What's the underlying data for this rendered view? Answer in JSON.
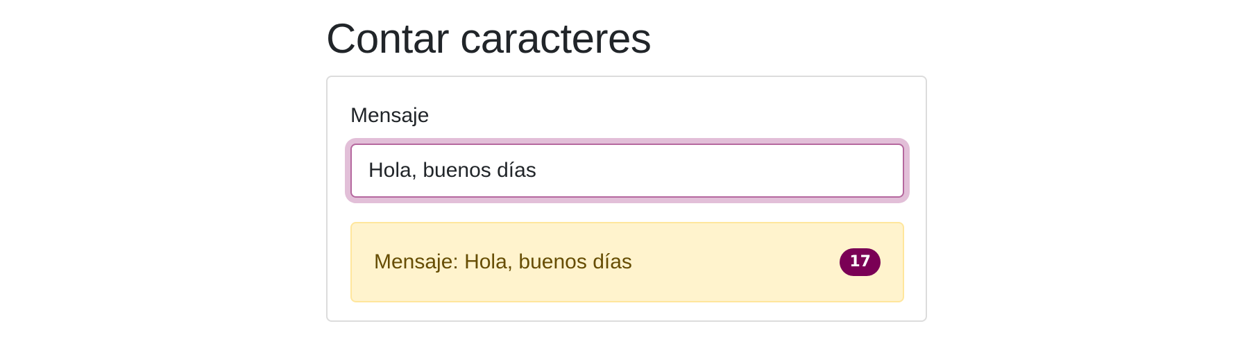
{
  "page": {
    "title": "Contar caracteres"
  },
  "form": {
    "label": "Mensaje",
    "input_value": "Hola, buenos días"
  },
  "result": {
    "text": "Mensaje: Hola, buenos días",
    "count": "17"
  },
  "colors": {
    "input_focus_border": "#b5679e",
    "input_focus_ring": "#e2bfd8",
    "alert_background": "#fff3cd",
    "alert_border": "#ffe69c",
    "alert_text": "#664d03",
    "badge_background": "#7a0055"
  }
}
